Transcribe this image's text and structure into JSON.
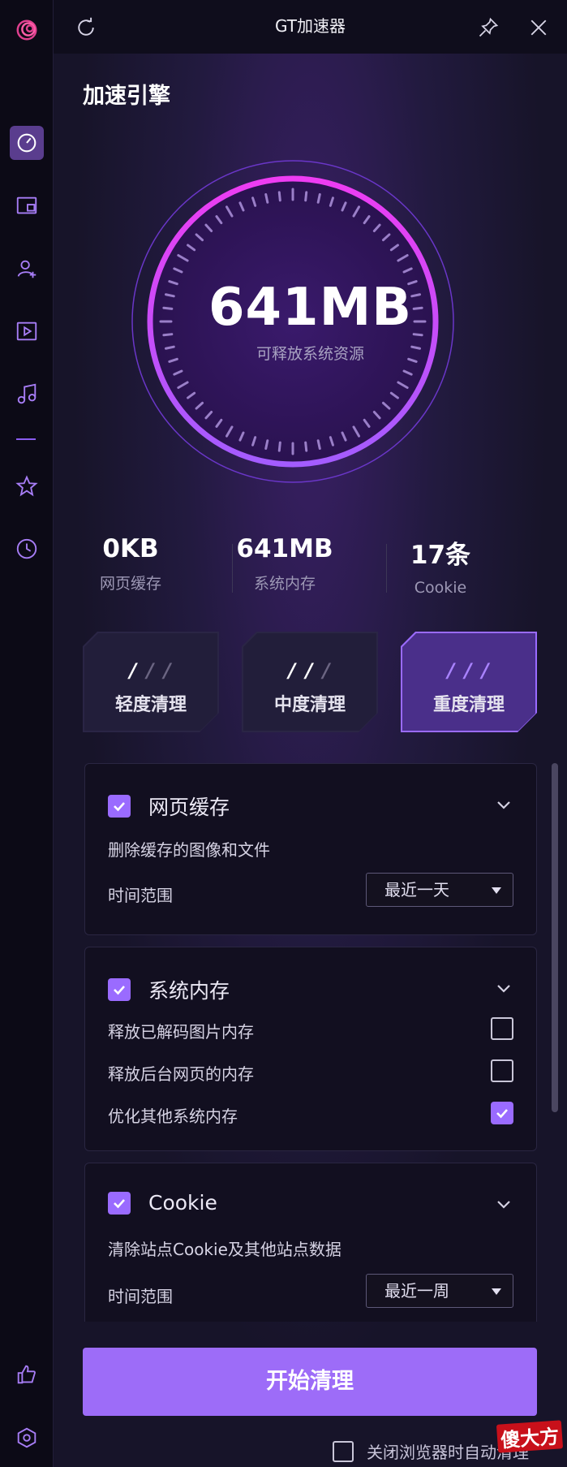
{
  "window": {
    "title": "GT加速器"
  },
  "engine": {
    "section_title": "加速引擎",
    "gauge_value": "641MB",
    "gauge_subtitle": "可释放系统资源"
  },
  "stats": [
    {
      "value": "0KB",
      "label": "网页缓存"
    },
    {
      "value": "641MB",
      "label": "系统内存"
    },
    {
      "value": "17条",
      "label": "Cookie"
    }
  ],
  "modes": [
    {
      "label": "轻度清理",
      "active": false
    },
    {
      "label": "中度清理",
      "active": false
    },
    {
      "label": "重度清理",
      "active": true
    }
  ],
  "panels": {
    "cache": {
      "title": "网页缓存",
      "checked": true,
      "desc": "删除缓存的图像和文件",
      "range_label": "时间范围",
      "range_value": "最近一天"
    },
    "memory": {
      "title": "系统内存",
      "checked": true,
      "options": [
        {
          "label": "释放已解码图片内存",
          "checked": false
        },
        {
          "label": "释放后台网页的内存",
          "checked": false
        },
        {
          "label": "优化其他系统内存",
          "checked": true
        }
      ]
    },
    "cookie": {
      "title": "Cookie",
      "checked": true,
      "desc": "清除站点Cookie及其他站点数据",
      "range_label": "时间范围",
      "range_value": "最近一周"
    }
  },
  "actions": {
    "start_label": "开始清理",
    "auto_clean_label": "关闭浏览器时自动清理",
    "auto_clean_checked": false
  },
  "watermark": "傻大方",
  "colors": {
    "accent": "#9d6cf8",
    "ring": "#d63cf0",
    "bg": "#161328"
  }
}
